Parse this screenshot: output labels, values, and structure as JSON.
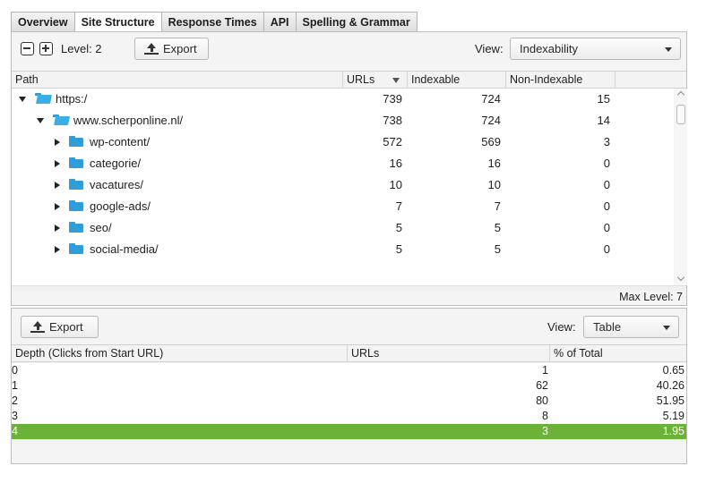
{
  "tabs": [
    "Overview",
    "Site Structure",
    "Response Times",
    "API",
    "Spelling & Grammar"
  ],
  "active_tab": "Site Structure",
  "structure_toolbar": {
    "level_label": "Level: 2",
    "export_label": "Export",
    "view_label": "View:",
    "view_value": "Indexability"
  },
  "tree_columns": [
    "Path",
    "URLs",
    "Indexable",
    "Non-Indexable"
  ],
  "tree_sort_column": "URLs",
  "tree_rows": [
    {
      "depth": 0,
      "expanded": true,
      "path": "https:/",
      "urls": "739",
      "indexable": "724",
      "non_indexable": "15"
    },
    {
      "depth": 1,
      "expanded": true,
      "path": "www.scherponline.nl/",
      "urls": "738",
      "indexable": "724",
      "non_indexable": "14"
    },
    {
      "depth": 2,
      "expanded": false,
      "path": "wp-content/",
      "urls": "572",
      "indexable": "569",
      "non_indexable": "3"
    },
    {
      "depth": 2,
      "expanded": false,
      "path": "categorie/",
      "urls": "16",
      "indexable": "16",
      "non_indexable": "0"
    },
    {
      "depth": 2,
      "expanded": false,
      "path": "vacatures/",
      "urls": "10",
      "indexable": "10",
      "non_indexable": "0"
    },
    {
      "depth": 2,
      "expanded": false,
      "path": "google-ads/",
      "urls": "7",
      "indexable": "7",
      "non_indexable": "0"
    },
    {
      "depth": 2,
      "expanded": false,
      "path": "seo/",
      "urls": "5",
      "indexable": "5",
      "non_indexable": "0"
    },
    {
      "depth": 2,
      "expanded": false,
      "path": "social-media/",
      "urls": "5",
      "indexable": "5",
      "non_indexable": "0"
    }
  ],
  "max_level_label": "Max Level: 7",
  "depth_toolbar": {
    "export_label": "Export",
    "view_label": "View:",
    "view_value": "Table"
  },
  "depth_columns": [
    "Depth (Clicks from Start URL)",
    "URLs",
    "% of Total"
  ],
  "depth_rows": [
    {
      "depth": "0",
      "urls": "1",
      "pct": "0.65"
    },
    {
      "depth": "1",
      "urls": "62",
      "pct": "40.26"
    },
    {
      "depth": "2",
      "urls": "80",
      "pct": "51.95"
    },
    {
      "depth": "3",
      "urls": "8",
      "pct": "5.19"
    },
    {
      "depth": "4",
      "urls": "3",
      "pct": "1.95"
    }
  ],
  "selected_depth_row": "4",
  "colors": {
    "selection": "#6bb337",
    "folder": "#2f9ed8"
  }
}
